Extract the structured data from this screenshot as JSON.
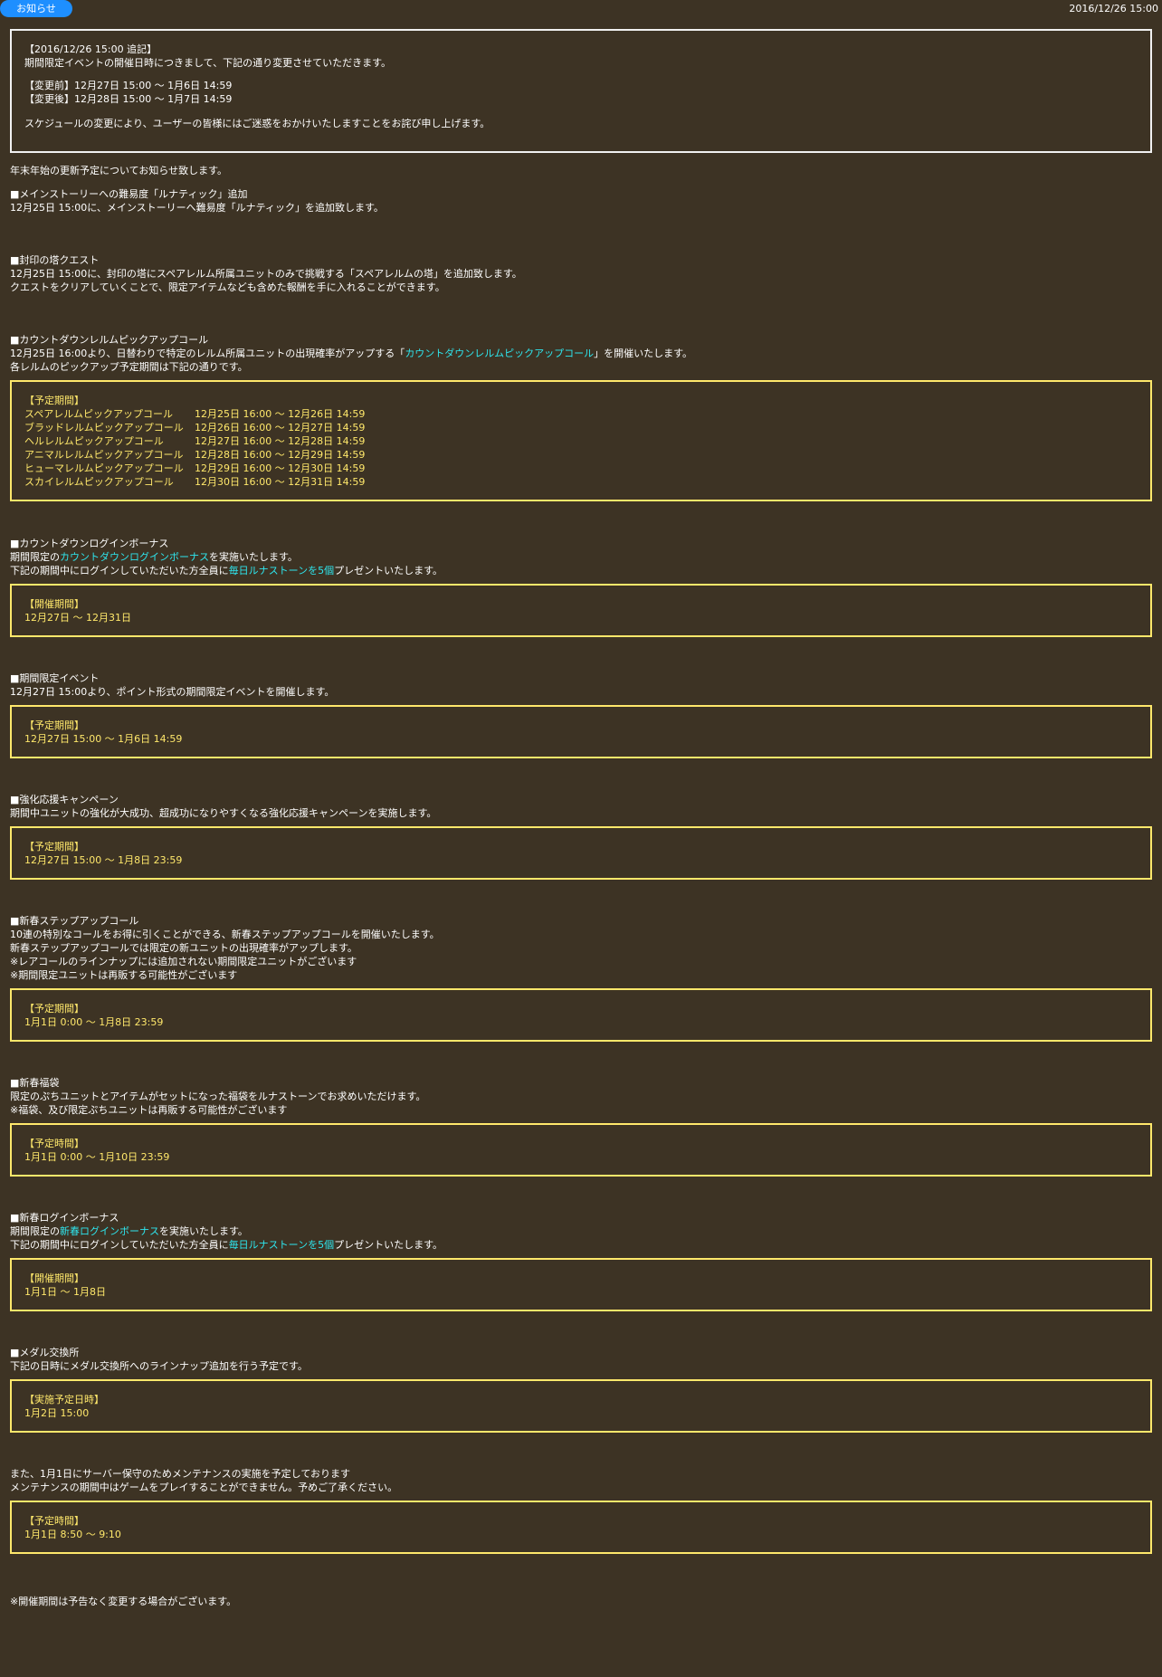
{
  "header": {
    "badge": "お知らせ",
    "date": "2016/12/26 15:00"
  },
  "update_box": {
    "title": "【2016/12/26 15:00 追記】",
    "line1": "期間限定イベントの開催日時につきまして、下記の通り変更させていただきます。",
    "before": "【変更前】12月27日 15:00 ～ 1月6日 14:59",
    "after": "【変更後】12月28日 15:00 ～ 1月7日 14:59",
    "apology": "スケジュールの変更により、ユーザーの皆様にはご迷惑をおかけいたしますことをお詫び申し上げます。"
  },
  "intro": "年末年始の更新予定についてお知らせ致します。",
  "s1": {
    "head": "■メインストーリーへの難易度「ルナティック」追加",
    "l1": "12月25日 15:00に、メインストーリーへ難易度「ルナティック」を追加致します。"
  },
  "s2": {
    "head": "■封印の塔クエスト",
    "l1": "12月25日 15:00に、封印の塔にスペアレルム所属ユニットのみで挑戦する「スペアレルムの塔」を追加致します。",
    "l2": "クエストをクリアしていくことで、限定アイテムなども含めた報酬を手に入れることができます。"
  },
  "s3": {
    "head": "■カウントダウンレルムピックアップコール",
    "l1a": "12月25日 16:00より、日替わりで特定のレルム所属ユニットの出現確率がアップする「",
    "l1link": "カウントダウンレルムピックアップコール",
    "l1b": "」を開催いたします。",
    "l2": "各レルムのピックアップ予定期間は下記の通りです。",
    "box_title": "【予定期間】",
    "rows": [
      {
        "name": "スペアレルムピックアップコール",
        "period": "12月25日 16:00 ～ 12月26日 14:59"
      },
      {
        "name": "ブラッドレルムピックアップコール",
        "period": "12月26日 16:00 ～ 12月27日 14:59"
      },
      {
        "name": "ヘルレルムピックアップコール",
        "period": "12月27日 16:00 ～ 12月28日 14:59"
      },
      {
        "name": "アニマルレルムピックアップコール",
        "period": "12月28日 16:00 ～ 12月29日 14:59"
      },
      {
        "name": "ヒューマレルムピックアップコール",
        "period": "12月29日 16:00 ～ 12月30日 14:59"
      },
      {
        "name": "スカイレルムピックアップコール",
        "period": "12月30日 16:00 ～ 12月31日 14:59"
      }
    ]
  },
  "s4": {
    "head": "■カウントダウンログインボーナス",
    "l1a": "期間限定の",
    "l1link": "カウントダウンログインボーナス",
    "l1b": "を実施いたします。",
    "l2a": "下記の期間中にログインしていただいた方全員に",
    "l2link": "毎日ルナストーンを5個",
    "l2b": "プレゼントいたします。",
    "box_title": "【開催期間】",
    "box_value": "12月27日 ～ 12月31日"
  },
  "s5": {
    "head": "■期間限定イベント",
    "l1": "12月27日 15:00より、ポイント形式の期間限定イベントを開催します。",
    "box_title": "【予定期間】",
    "box_value": "12月27日 15:00 ～ 1月6日 14:59"
  },
  "s6": {
    "head": "■強化応援キャンペーン",
    "l1": "期間中ユニットの強化が大成功、超成功になりやすくなる強化応援キャンペーンを実施します。",
    "box_title": "【予定期間】",
    "box_value": "12月27日 15:00 ～ 1月8日 23:59"
  },
  "s7": {
    "head": "■新春ステップアップコール",
    "l1": "10連の特別なコールをお得に引くことができる、新春ステップアップコールを開催いたします。",
    "l2": "新春ステップアップコールでは限定の新ユニットの出現確率がアップします。",
    "l3": "※レアコールのラインナップには追加されない期間限定ユニットがございます",
    "l4": "※期間限定ユニットは再販する可能性がございます",
    "box_title": "【予定期間】",
    "box_value": "1月1日 0:00 ～ 1月8日 23:59"
  },
  "s8": {
    "head": "■新春福袋",
    "l1": "限定のぷちユニットとアイテムがセットになった福袋をルナストーンでお求めいただけます。",
    "l2": "※福袋、及び限定ぷちユニットは再販する可能性がございます",
    "box_title": "【予定時間】",
    "box_value": "1月1日 0:00 ～ 1月10日 23:59"
  },
  "s9": {
    "head": "■新春ログインボーナス",
    "l1a": "期間限定の",
    "l1link": "新春ログインボーナス",
    "l1b": "を実施いたします。",
    "l2a": "下記の期間中にログインしていただいた方全員に",
    "l2link": "毎日ルナストーンを5個",
    "l2b": "プレゼントいたします。",
    "box_title": "【開催期間】",
    "box_value": "1月1日 ～ 1月8日"
  },
  "s10": {
    "head": "■メダル交換所",
    "l1": "下記の日時にメダル交換所へのラインナップ追加を行う予定です。",
    "box_title": "【実施予定日時】",
    "box_value": "1月2日 15:00"
  },
  "s11": {
    "l1": "また、1月1日にサーバー保守のためメンテナンスの実施を予定しております",
    "l2": "メンテナンスの期間中はゲームをプレイすることができません。予めご了承ください。",
    "box_title": "【予定時間】",
    "box_value": "1月1日 8:50 ～ 9:10"
  },
  "footer_note": "※開催期間は予告なく変更する場合がございます。"
}
